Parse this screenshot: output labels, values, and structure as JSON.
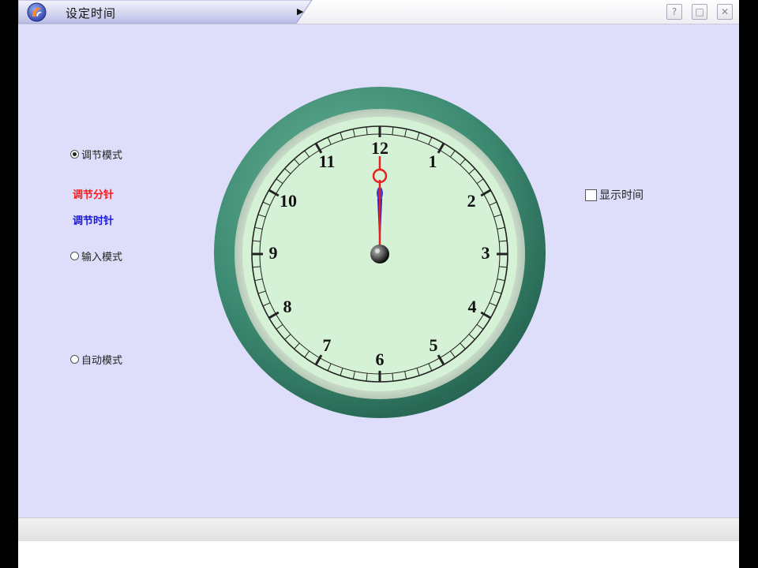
{
  "window": {
    "title": "设定时间",
    "help_label": "?",
    "restore_label": "□",
    "close_label": "✕"
  },
  "modes": {
    "adjust_mode": "调节模式",
    "adjust_minute": "调节分针",
    "adjust_hour": "调节时针",
    "input_mode": "输入模式",
    "auto_mode": "自动模式",
    "selected": "调节模式"
  },
  "show_time": {
    "label": "显示时间",
    "checked": false
  },
  "clock": {
    "numbers": [
      "12",
      "1",
      "2",
      "3",
      "4",
      "5",
      "6",
      "7",
      "8",
      "9",
      "10",
      "11"
    ],
    "hour": 12,
    "minute": 0
  },
  "colors": {
    "background": "#dedefb",
    "minute_hand": "#e52020",
    "hour_hand": "#2020c0",
    "clock_rim": "#3d8a72",
    "clock_face": "#d6f2d6"
  }
}
